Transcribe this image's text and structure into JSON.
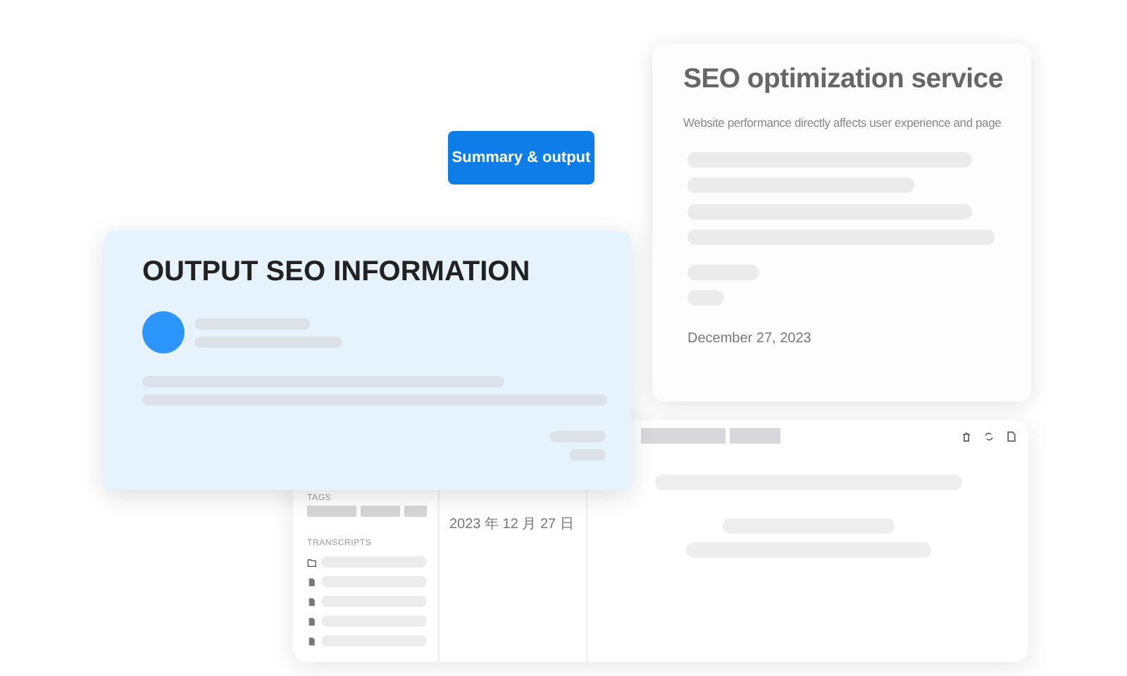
{
  "seo_card": {
    "title": "SEO optimization service",
    "subtitle": "Website performance directly affects user experience and page",
    "date": "December 27, 2023"
  },
  "summary_button": {
    "label": "Summary & output"
  },
  "output_card": {
    "title": "OUTPUT SEO INFORMATION"
  },
  "app_window": {
    "tags_label": "TAGS",
    "transcripts_label": "TRANSCRIPTS",
    "date": "2023 年 12 月 27 日",
    "transcripts": [
      {
        "kind": "folder"
      },
      {
        "kind": "file"
      },
      {
        "kind": "file"
      },
      {
        "kind": "file"
      },
      {
        "kind": "file"
      }
    ]
  }
}
